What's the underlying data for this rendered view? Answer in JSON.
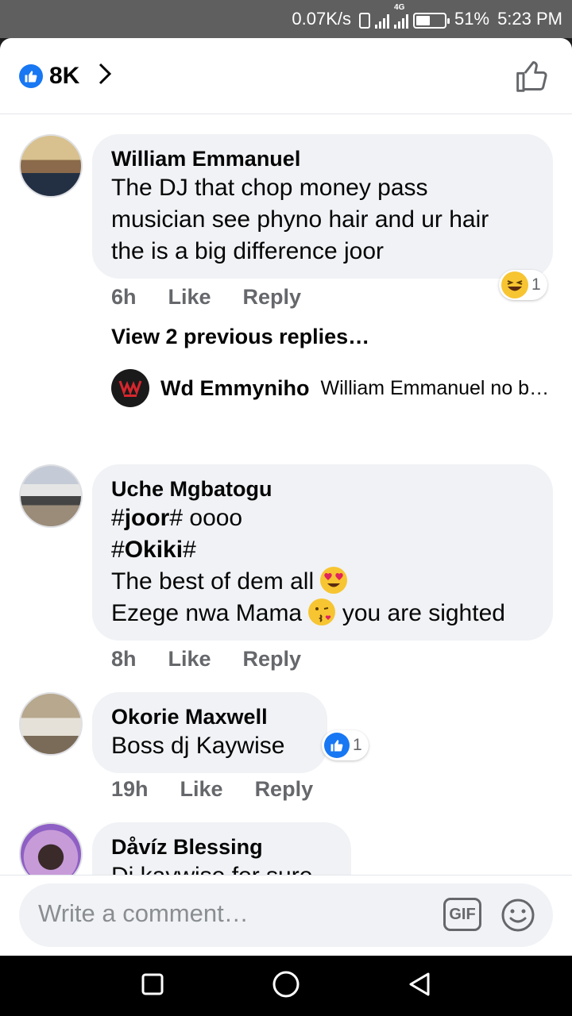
{
  "status_bar": {
    "speed": "0.07K/s",
    "network": "4G",
    "battery": "51%",
    "time": "5:23 PM"
  },
  "header": {
    "reaction_count": "8K",
    "icons": [
      "like-icon",
      "chevron-right-icon",
      "thumbs-up-outline-icon"
    ]
  },
  "comments": [
    {
      "author": "William Emmanuel",
      "lines": [
        "The DJ that chop money pass",
        "musician see phyno hair and ur hair",
        "the is a big difference joor"
      ],
      "time": "6h",
      "like": "Like",
      "reply": "Reply",
      "reaction_count": "1",
      "reaction_icon": "laughing-emoji-icon",
      "view_previous": "View 2 previous replies…",
      "latest_reply": {
        "author": "Wd Emmyniho",
        "snippet": "William Emmanuel no b…"
      }
    },
    {
      "author": "Uche Mgbatogu",
      "line1_bold": "joor",
      "line1_rest": " oooo",
      "line2_bold": "Okiki",
      "line3": "The best of dem all",
      "line4_a": "Ezege nwa Mama",
      "line4_b": "you are sighted",
      "hash": "#",
      "time": "8h",
      "like": "Like",
      "reply": "Reply"
    },
    {
      "author": "Okorie Maxwell",
      "text": "Boss dj Kaywise",
      "time": "19h",
      "like": "Like",
      "reply": "Reply",
      "reaction_count": "1",
      "reaction_icon": "like-icon"
    },
    {
      "author": "Dåvíz Blessing",
      "text": "Dj kaywise for sure"
    }
  ],
  "composer": {
    "placeholder": "Write a comment…",
    "gif_label": "GIF"
  },
  "colors": {
    "accent": "#1877f2",
    "bubble": "#f0f2f5",
    "meta_text": "#65676b"
  }
}
